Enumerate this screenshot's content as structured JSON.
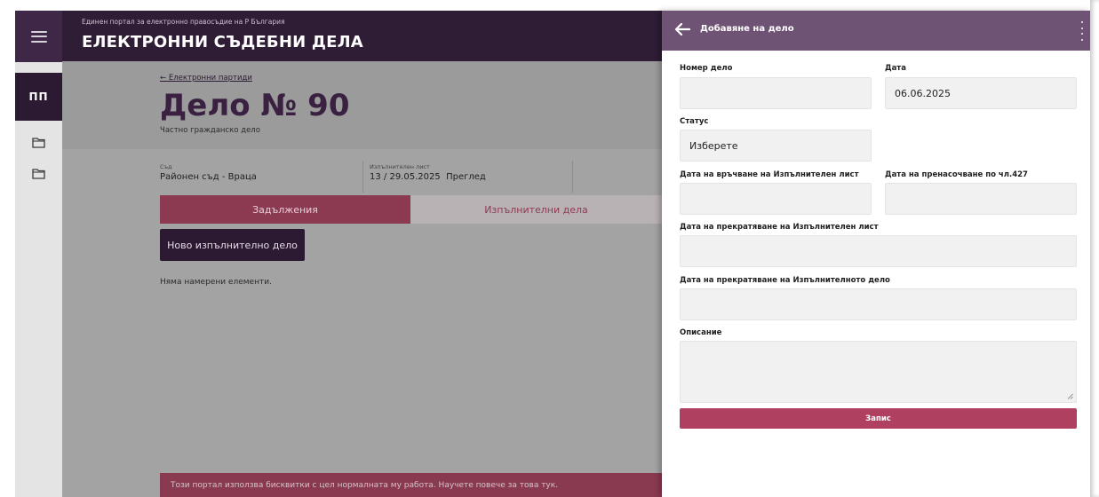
{
  "header": {
    "subtitle": "Единен портал за електронно правосъдие на Р България",
    "title": "ЕЛЕКТРОННИ СЪДЕБНИ ДЕЛА"
  },
  "rail": {
    "menu_icon": "hamburger-icon",
    "active_item": "ПП",
    "folder_icon": "folder-icon"
  },
  "case": {
    "back_link": "← Електронни партиди",
    "title": "Дело № 90",
    "subtitle": "Частно гражданско дело",
    "court_label": "Съд",
    "court_value": "Районен съд - Враца",
    "writ_label": "Изпълнителен лист",
    "writ_value": "13 / 29.05.2025",
    "writ_link": "Преглед"
  },
  "tabs": [
    {
      "label": "Задължения",
      "active": true
    },
    {
      "label": "Изпълнителни дела",
      "active": false
    }
  ],
  "new_case_button": "Ново изпълнително дело",
  "empty_message": "Няма намерени елементи.",
  "cookie_notice": "Този портал използва бисквитки с цел нормалната му работа. Научете повече за това тук.",
  "drawer": {
    "title": "Добавяне на дело",
    "fields": {
      "case_number": {
        "label": "Номер дело",
        "value": ""
      },
      "date": {
        "label": "Дата",
        "value": "06.06.2025"
      },
      "status": {
        "label": "Статус",
        "value": "Изберете"
      },
      "service_date": {
        "label": "Дата на връчване на Изпълнителен лист",
        "value": ""
      },
      "redirect_date": {
        "label": "Дата на пренасочване по чл.427",
        "value": ""
      },
      "writ_termination_date": {
        "label": "Дата на прекратяване на Изпълнителен лист",
        "value": ""
      },
      "case_termination_date": {
        "label": "Дата на прекратяване на Изпълнителното дело",
        "value": ""
      },
      "description": {
        "label": "Описание",
        "value": ""
      }
    },
    "save_button": "Запис"
  },
  "colors": {
    "header_bg": "#2f1c35",
    "drawer_header_bg": "#6f5374",
    "accent": "#b0405f",
    "primary_dark": "#2c1a33"
  }
}
